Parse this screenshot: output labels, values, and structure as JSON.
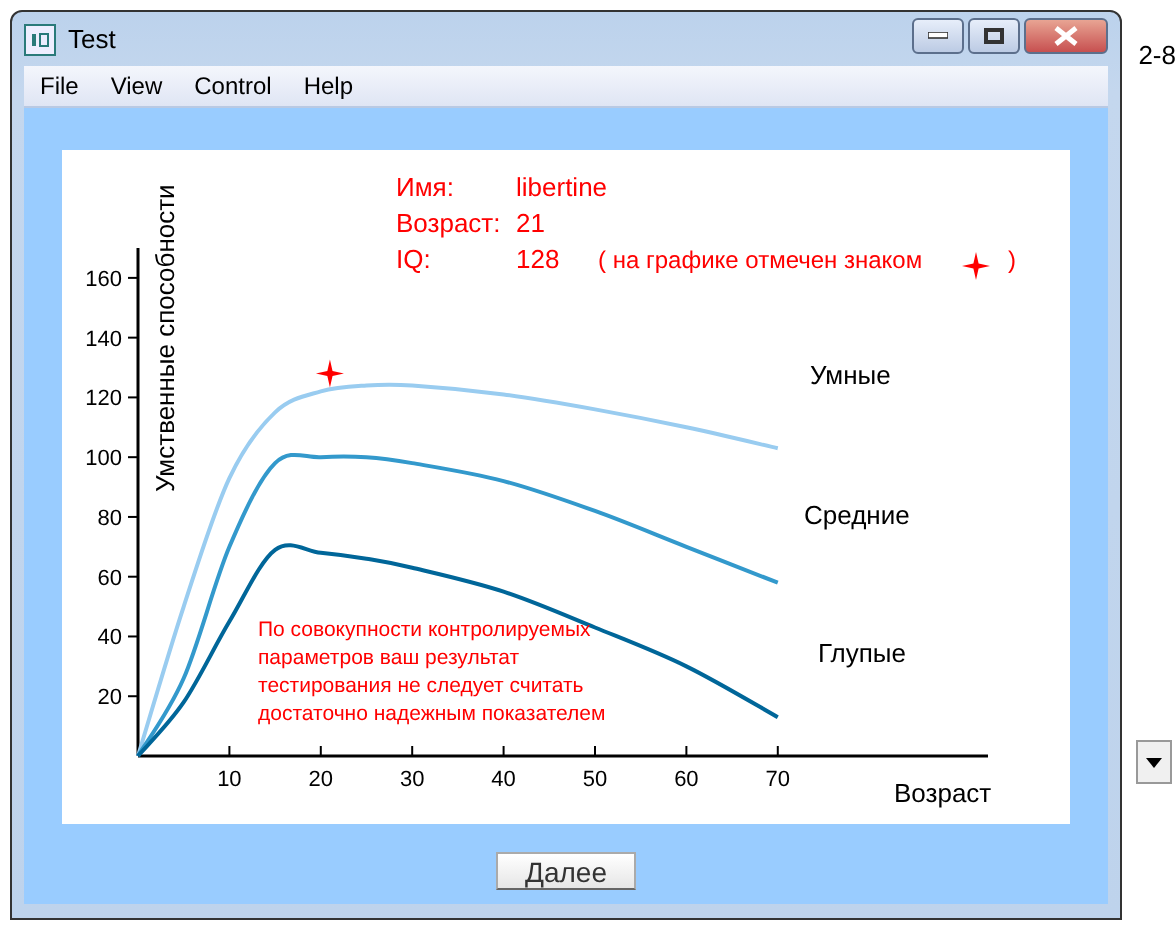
{
  "window": {
    "title": "Test"
  },
  "background": {
    "fragment": "2-8"
  },
  "menu": [
    "File",
    "View",
    "Control",
    "Help"
  ],
  "info": [
    {
      "label": "Имя:",
      "value": "libertine"
    },
    {
      "label": "Возраст:",
      "value": "21"
    },
    {
      "label": "IQ:",
      "value": "128",
      "note_open": "( на графике отмечен знаком",
      "note_close": ")"
    }
  ],
  "note": "По совокупности контролируемых параметров ваш результат тестирования не следует считать достаточно надежным показателем",
  "chart_data": {
    "type": "line",
    "xlabel": "Возраст",
    "ylabel": "Умственные способности",
    "x": [
      0,
      5,
      10,
      15,
      20,
      25,
      30,
      40,
      50,
      60,
      70
    ],
    "xlim": [
      0,
      93
    ],
    "ylim": [
      0,
      170
    ],
    "xticks": [
      10,
      20,
      30,
      40,
      50,
      60,
      70
    ],
    "yticks": [
      20,
      40,
      60,
      80,
      100,
      120,
      140,
      160
    ],
    "series": [
      {
        "name": "Умные",
        "color": "#99ccf0",
        "values": [
          0,
          50,
          93,
          115,
          122,
          124,
          124,
          121,
          116,
          110,
          103
        ]
      },
      {
        "name": "Средние",
        "color": "#3399cc",
        "values": [
          0,
          26,
          70,
          98,
          100,
          100,
          98,
          92,
          82,
          70,
          58
        ]
      },
      {
        "name": "Глупые",
        "color": "#006699",
        "values": [
          0,
          18,
          45,
          69,
          68,
          66,
          63,
          55,
          43,
          30,
          13
        ]
      }
    ]
  },
  "buttons": [
    "Далее"
  ]
}
